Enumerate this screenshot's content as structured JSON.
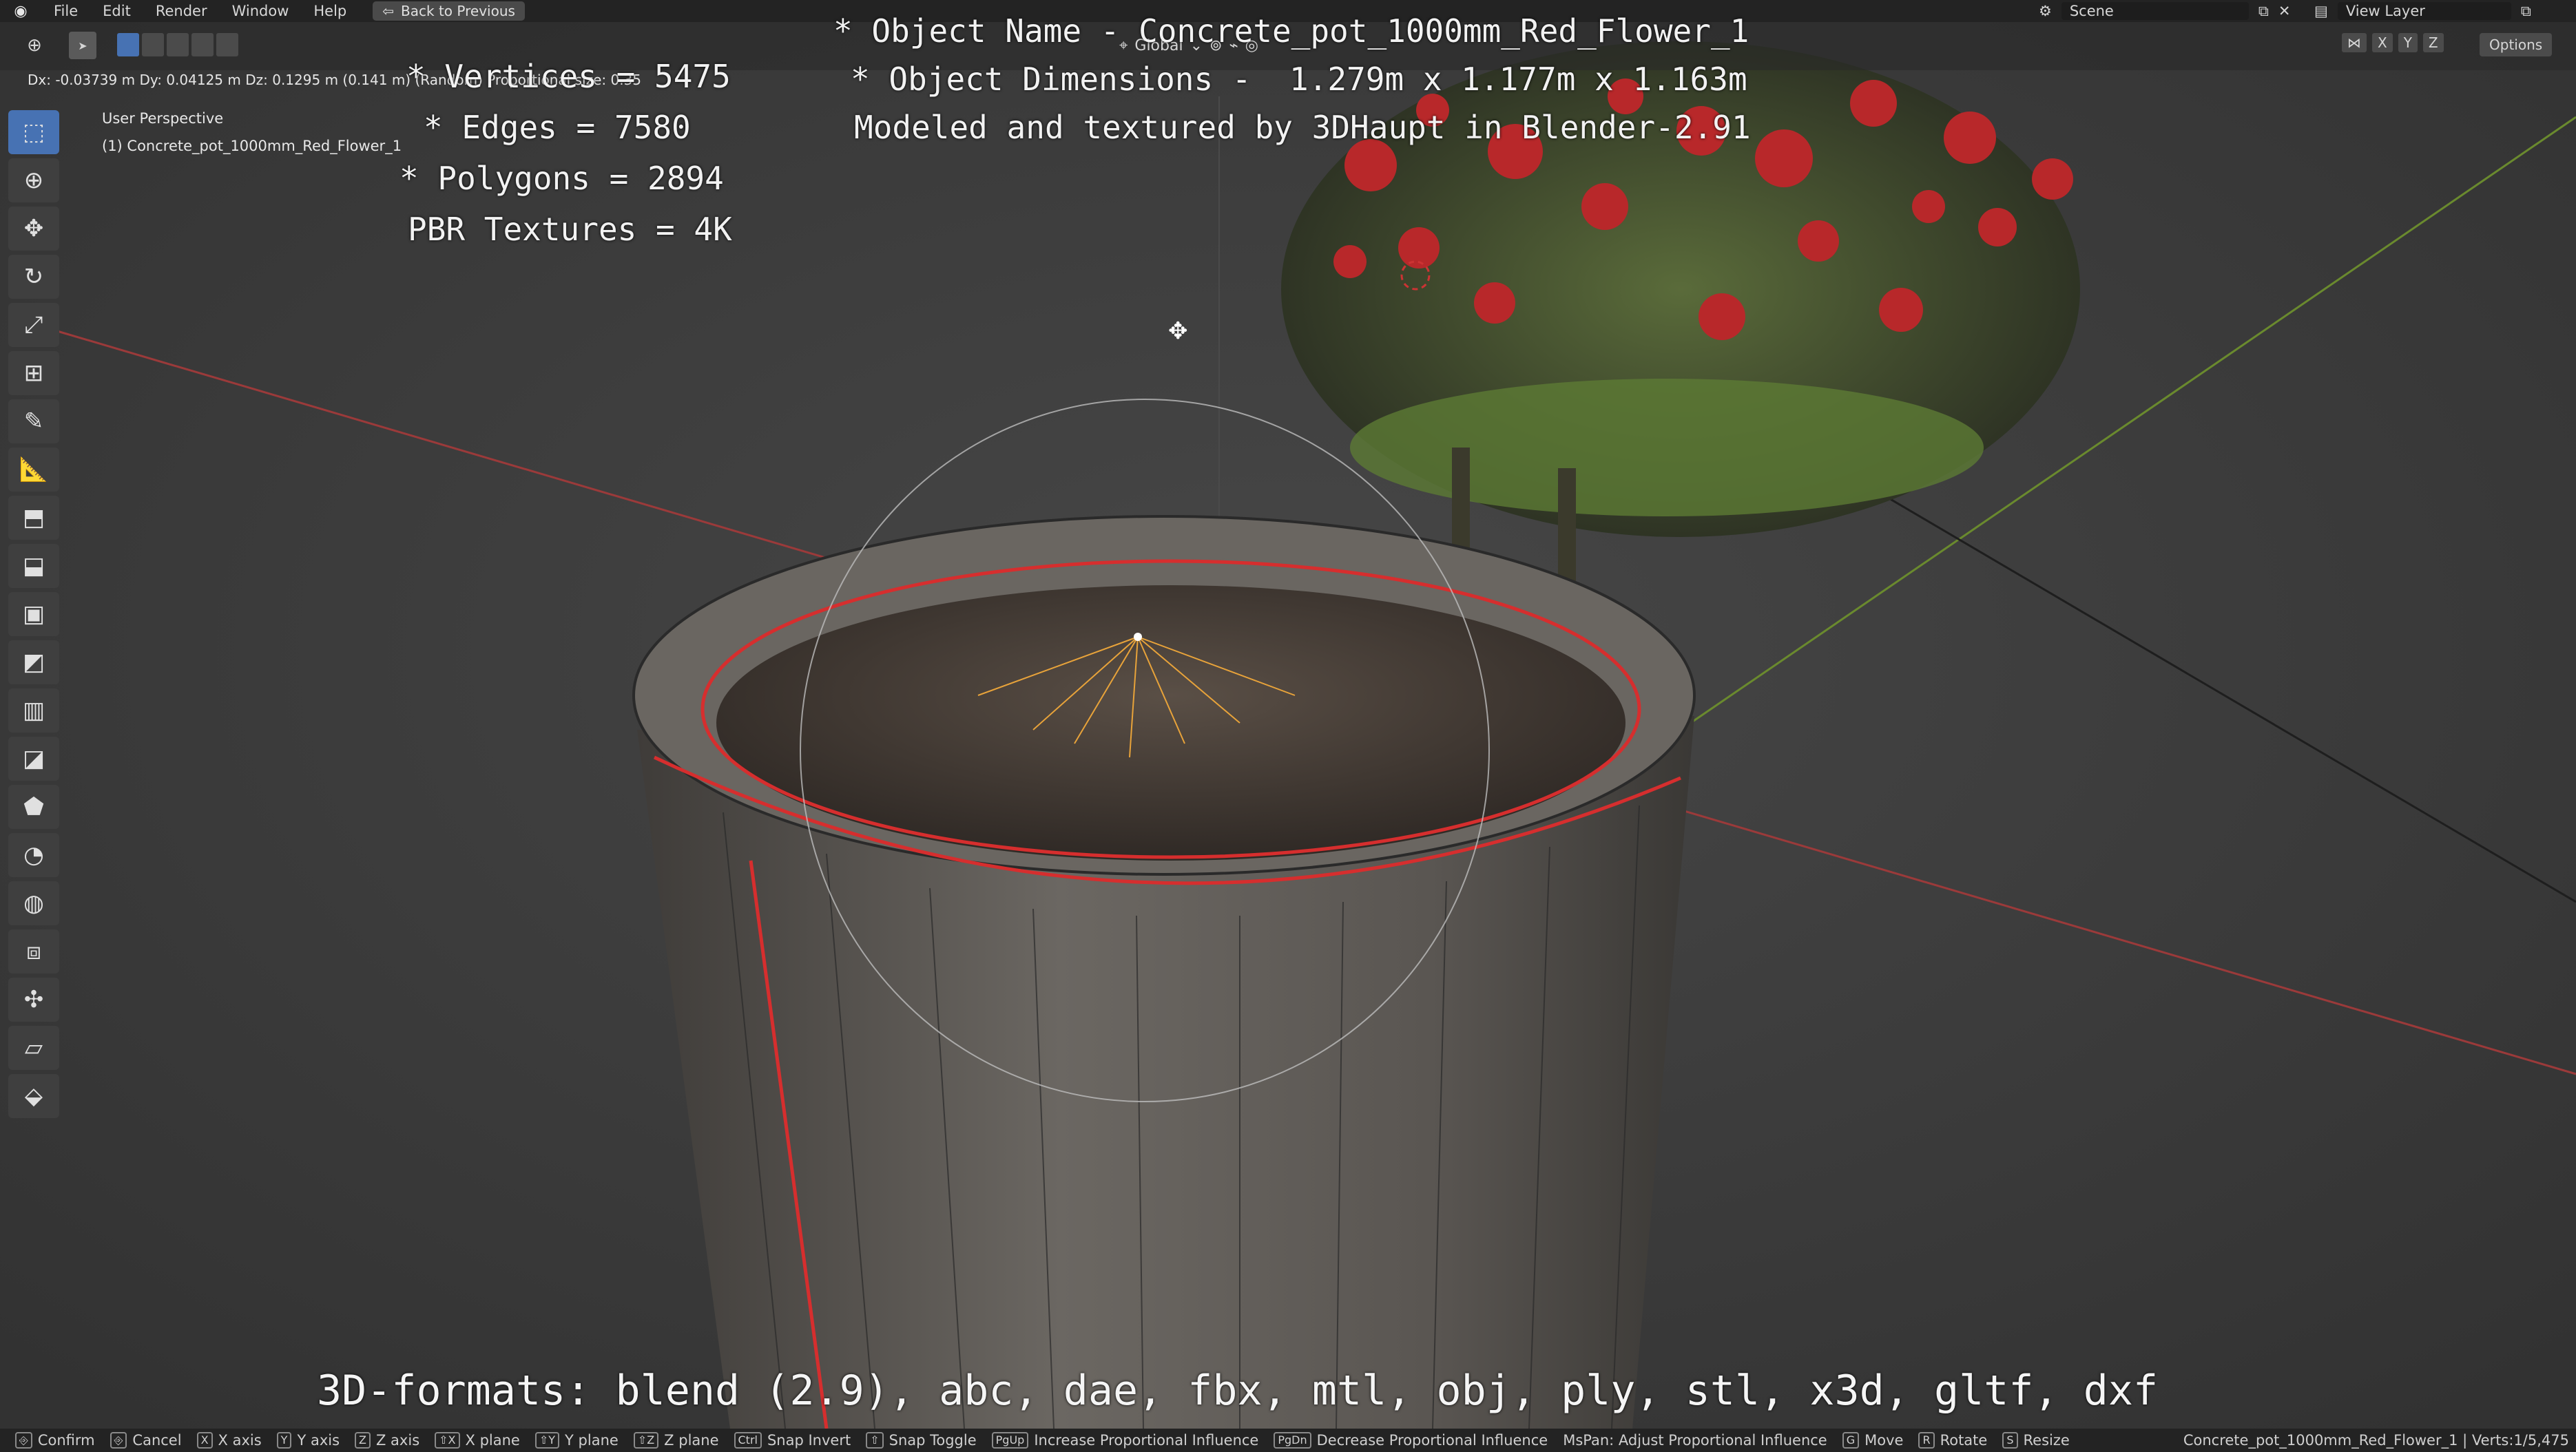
{
  "menu": {
    "logo_icon": "blender-logo-icon",
    "items": [
      "File",
      "Edit",
      "Render",
      "Window",
      "Help"
    ],
    "back_button": "Back to Previous"
  },
  "scene": {
    "label": "Scene"
  },
  "view_layer": {
    "label": "View Layer"
  },
  "viewport_header": {
    "orientation": "Global",
    "axes": [
      "X",
      "Y",
      "Z"
    ],
    "options": "Options"
  },
  "transform_readout": "Dx: -0.03739 m  Dy: 0.04125 m  Dz: 0.1295 m (0.141 m) (Random)  Proportional size: 0.35",
  "view": {
    "name": "User Perspective",
    "object": "(1) Concrete_pot_1000mm_Red_Flower_1"
  },
  "overlay": {
    "object_name": "* Object Name - Concrete_pot_1000mm_Red_Flower_1",
    "dimensions": "* Object Dimensions -  1.279m x 1.177m x 1.163m",
    "credits": "Modeled and textured by 3DHaupt in Blender-2.91",
    "vertices": "* Vertices = 5475",
    "edges": "* Edges = 7580",
    "polygons": "* Polygons = 2894",
    "textures": "PBR Textures = 4K",
    "formats": "3D-formats: blend (2.9), abc, dae, fbx, mtl, obj, ply, stl, x3d, gltf, dxf"
  },
  "tools": [
    "select-box-icon",
    "cursor-icon",
    "move-icon",
    "rotate-icon",
    "scale-icon",
    "transform-icon",
    "annotate-icon",
    "measure-icon",
    "add-cube-icon",
    "extrude-icon",
    "inset-icon",
    "bevel-icon",
    "loop-cut-icon",
    "knife-icon",
    "poly-build-icon",
    "spin-icon",
    "smooth-icon",
    "edge-slide-icon",
    "shrink-fatten-icon",
    "shear-icon",
    "rip-icon"
  ],
  "status": {
    "hints": [
      {
        "key": "⎆",
        "label": "Confirm"
      },
      {
        "key": "⎆",
        "label": "Cancel"
      },
      {
        "key": "X",
        "label": "X axis"
      },
      {
        "key": "Y",
        "label": "Y axis"
      },
      {
        "key": "Z",
        "label": "Z axis"
      },
      {
        "key": "⇧X",
        "label": "X plane"
      },
      {
        "key": "⇧Y",
        "label": "Y plane"
      },
      {
        "key": "⇧Z",
        "label": "Z plane"
      },
      {
        "key": "Ctrl",
        "label": "Snap Invert"
      },
      {
        "key": "⇧",
        "label": "Snap Toggle"
      },
      {
        "key": "PgUp",
        "label": "Increase Proportional Influence"
      },
      {
        "key": "PgDn",
        "label": "Decrease Proportional Influence"
      },
      {
        "key": "",
        "label": "MsPan: Adjust Proportional Influence"
      },
      {
        "key": "G",
        "label": "Move"
      },
      {
        "key": "R",
        "label": "Rotate"
      },
      {
        "key": "S",
        "label": "Resize"
      }
    ],
    "stats": "Concrete_pot_1000mm_Red_Flower_1 | Verts:1/5,475"
  }
}
